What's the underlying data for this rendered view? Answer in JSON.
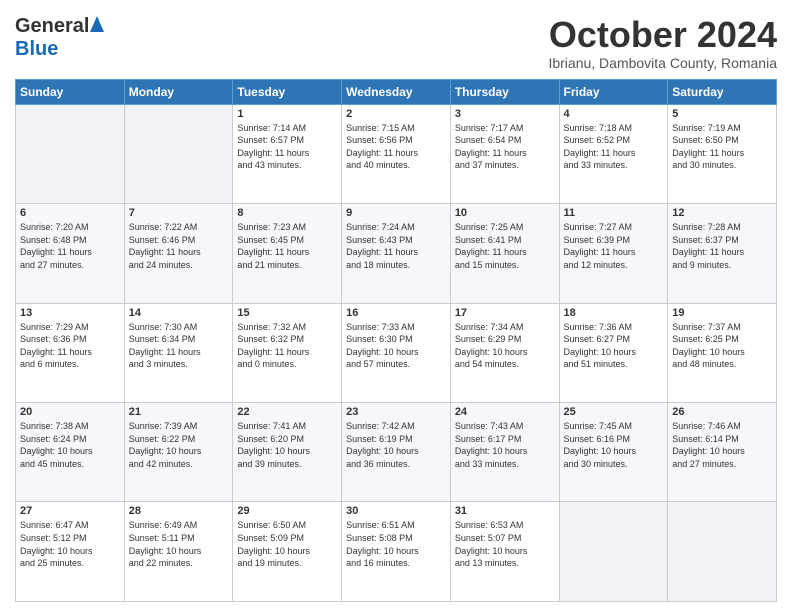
{
  "header": {
    "logo_general": "General",
    "logo_blue": "Blue",
    "month": "October 2024",
    "location": "Ibrianu, Dambovita County, Romania"
  },
  "weekdays": [
    "Sunday",
    "Monday",
    "Tuesday",
    "Wednesday",
    "Thursday",
    "Friday",
    "Saturday"
  ],
  "weeks": [
    [
      {
        "day": "",
        "lines": []
      },
      {
        "day": "",
        "lines": []
      },
      {
        "day": "1",
        "lines": [
          "Sunrise: 7:14 AM",
          "Sunset: 6:57 PM",
          "Daylight: 11 hours",
          "and 43 minutes."
        ]
      },
      {
        "day": "2",
        "lines": [
          "Sunrise: 7:15 AM",
          "Sunset: 6:56 PM",
          "Daylight: 11 hours",
          "and 40 minutes."
        ]
      },
      {
        "day": "3",
        "lines": [
          "Sunrise: 7:17 AM",
          "Sunset: 6:54 PM",
          "Daylight: 11 hours",
          "and 37 minutes."
        ]
      },
      {
        "day": "4",
        "lines": [
          "Sunrise: 7:18 AM",
          "Sunset: 6:52 PM",
          "Daylight: 11 hours",
          "and 33 minutes."
        ]
      },
      {
        "day": "5",
        "lines": [
          "Sunrise: 7:19 AM",
          "Sunset: 6:50 PM",
          "Daylight: 11 hours",
          "and 30 minutes."
        ]
      }
    ],
    [
      {
        "day": "6",
        "lines": [
          "Sunrise: 7:20 AM",
          "Sunset: 6:48 PM",
          "Daylight: 11 hours",
          "and 27 minutes."
        ]
      },
      {
        "day": "7",
        "lines": [
          "Sunrise: 7:22 AM",
          "Sunset: 6:46 PM",
          "Daylight: 11 hours",
          "and 24 minutes."
        ]
      },
      {
        "day": "8",
        "lines": [
          "Sunrise: 7:23 AM",
          "Sunset: 6:45 PM",
          "Daylight: 11 hours",
          "and 21 minutes."
        ]
      },
      {
        "day": "9",
        "lines": [
          "Sunrise: 7:24 AM",
          "Sunset: 6:43 PM",
          "Daylight: 11 hours",
          "and 18 minutes."
        ]
      },
      {
        "day": "10",
        "lines": [
          "Sunrise: 7:25 AM",
          "Sunset: 6:41 PM",
          "Daylight: 11 hours",
          "and 15 minutes."
        ]
      },
      {
        "day": "11",
        "lines": [
          "Sunrise: 7:27 AM",
          "Sunset: 6:39 PM",
          "Daylight: 11 hours",
          "and 12 minutes."
        ]
      },
      {
        "day": "12",
        "lines": [
          "Sunrise: 7:28 AM",
          "Sunset: 6:37 PM",
          "Daylight: 11 hours",
          "and 9 minutes."
        ]
      }
    ],
    [
      {
        "day": "13",
        "lines": [
          "Sunrise: 7:29 AM",
          "Sunset: 6:36 PM",
          "Daylight: 11 hours",
          "and 6 minutes."
        ]
      },
      {
        "day": "14",
        "lines": [
          "Sunrise: 7:30 AM",
          "Sunset: 6:34 PM",
          "Daylight: 11 hours",
          "and 3 minutes."
        ]
      },
      {
        "day": "15",
        "lines": [
          "Sunrise: 7:32 AM",
          "Sunset: 6:32 PM",
          "Daylight: 11 hours",
          "and 0 minutes."
        ]
      },
      {
        "day": "16",
        "lines": [
          "Sunrise: 7:33 AM",
          "Sunset: 6:30 PM",
          "Daylight: 10 hours",
          "and 57 minutes."
        ]
      },
      {
        "day": "17",
        "lines": [
          "Sunrise: 7:34 AM",
          "Sunset: 6:29 PM",
          "Daylight: 10 hours",
          "and 54 minutes."
        ]
      },
      {
        "day": "18",
        "lines": [
          "Sunrise: 7:36 AM",
          "Sunset: 6:27 PM",
          "Daylight: 10 hours",
          "and 51 minutes."
        ]
      },
      {
        "day": "19",
        "lines": [
          "Sunrise: 7:37 AM",
          "Sunset: 6:25 PM",
          "Daylight: 10 hours",
          "and 48 minutes."
        ]
      }
    ],
    [
      {
        "day": "20",
        "lines": [
          "Sunrise: 7:38 AM",
          "Sunset: 6:24 PM",
          "Daylight: 10 hours",
          "and 45 minutes."
        ]
      },
      {
        "day": "21",
        "lines": [
          "Sunrise: 7:39 AM",
          "Sunset: 6:22 PM",
          "Daylight: 10 hours",
          "and 42 minutes."
        ]
      },
      {
        "day": "22",
        "lines": [
          "Sunrise: 7:41 AM",
          "Sunset: 6:20 PM",
          "Daylight: 10 hours",
          "and 39 minutes."
        ]
      },
      {
        "day": "23",
        "lines": [
          "Sunrise: 7:42 AM",
          "Sunset: 6:19 PM",
          "Daylight: 10 hours",
          "and 36 minutes."
        ]
      },
      {
        "day": "24",
        "lines": [
          "Sunrise: 7:43 AM",
          "Sunset: 6:17 PM",
          "Daylight: 10 hours",
          "and 33 minutes."
        ]
      },
      {
        "day": "25",
        "lines": [
          "Sunrise: 7:45 AM",
          "Sunset: 6:16 PM",
          "Daylight: 10 hours",
          "and 30 minutes."
        ]
      },
      {
        "day": "26",
        "lines": [
          "Sunrise: 7:46 AM",
          "Sunset: 6:14 PM",
          "Daylight: 10 hours",
          "and 27 minutes."
        ]
      }
    ],
    [
      {
        "day": "27",
        "lines": [
          "Sunrise: 6:47 AM",
          "Sunset: 5:12 PM",
          "Daylight: 10 hours",
          "and 25 minutes."
        ]
      },
      {
        "day": "28",
        "lines": [
          "Sunrise: 6:49 AM",
          "Sunset: 5:11 PM",
          "Daylight: 10 hours",
          "and 22 minutes."
        ]
      },
      {
        "day": "29",
        "lines": [
          "Sunrise: 6:50 AM",
          "Sunset: 5:09 PM",
          "Daylight: 10 hours",
          "and 19 minutes."
        ]
      },
      {
        "day": "30",
        "lines": [
          "Sunrise: 6:51 AM",
          "Sunset: 5:08 PM",
          "Daylight: 10 hours",
          "and 16 minutes."
        ]
      },
      {
        "day": "31",
        "lines": [
          "Sunrise: 6:53 AM",
          "Sunset: 5:07 PM",
          "Daylight: 10 hours",
          "and 13 minutes."
        ]
      },
      {
        "day": "",
        "lines": []
      },
      {
        "day": "",
        "lines": []
      }
    ]
  ]
}
